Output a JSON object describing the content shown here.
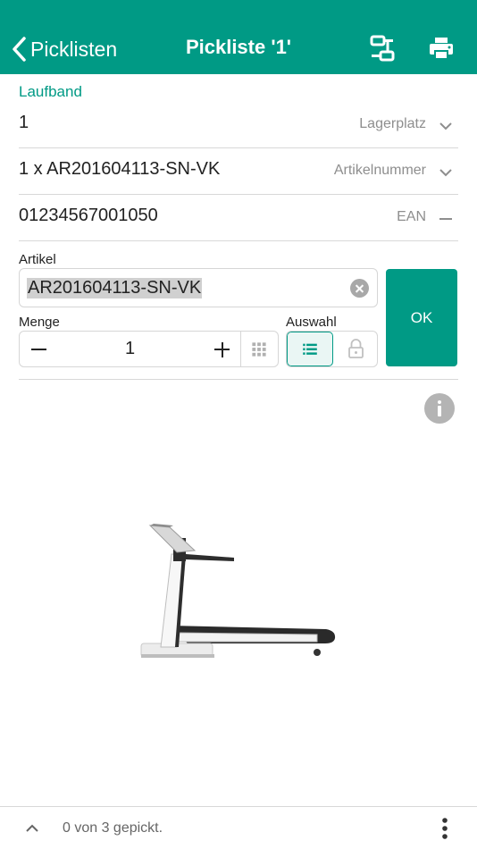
{
  "header": {
    "back_label": "Picklisten",
    "title": "Pickliste '1'",
    "icons": [
      "switch-icon",
      "print-icon"
    ],
    "color": "#009a85"
  },
  "section_title": "Laufband",
  "fields": [
    {
      "value": "1",
      "label": "Lagerplatz",
      "control": "chevron-down-icon"
    },
    {
      "value": "1 x AR201604113-SN-VK",
      "label": "Artikelnummer",
      "control": "chevron-down-icon"
    },
    {
      "value": "01234567001050",
      "label": "EAN",
      "control": "minus-icon"
    }
  ],
  "artikel": {
    "label": "Artikel",
    "value": "AR201604113-SN-VK"
  },
  "menge": {
    "label": "Menge",
    "value": "1"
  },
  "auswahl": {
    "label": "Auswahl",
    "options": [
      "list-icon",
      "lock-icon"
    ],
    "selected": "list-icon"
  },
  "ok_button": "OK",
  "product_image": "treadmill-image",
  "footer": {
    "status": "0 von 3 gepickt."
  }
}
